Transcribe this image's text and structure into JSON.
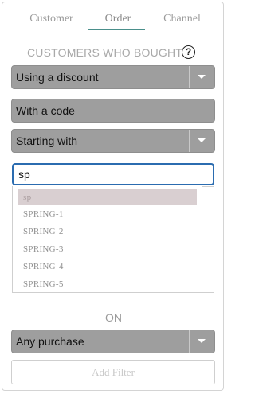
{
  "tabs": [
    {
      "label": "Customer"
    },
    {
      "label": "Order"
    },
    {
      "label": "Channel"
    }
  ],
  "heading": "CUSTOMERS WHO BOUGHT",
  "help_symbol": "?",
  "selects": {
    "discount": "Using a discount",
    "code": "With a code",
    "match": "Starting with",
    "purchase": "Any purchase"
  },
  "search": {
    "value": "sp"
  },
  "options": [
    "sp",
    "SPRING-1",
    "SPRING-2",
    "SPRING-3",
    "SPRING-4",
    "SPRING-5"
  ],
  "on_label": "ON",
  "add_filter": "Add Filter",
  "colors": {
    "accent": "#4a8f8b",
    "select_bg": "#9e9e9e",
    "focus": "#2b6cb0",
    "selected_option": "#d9cfd1"
  }
}
